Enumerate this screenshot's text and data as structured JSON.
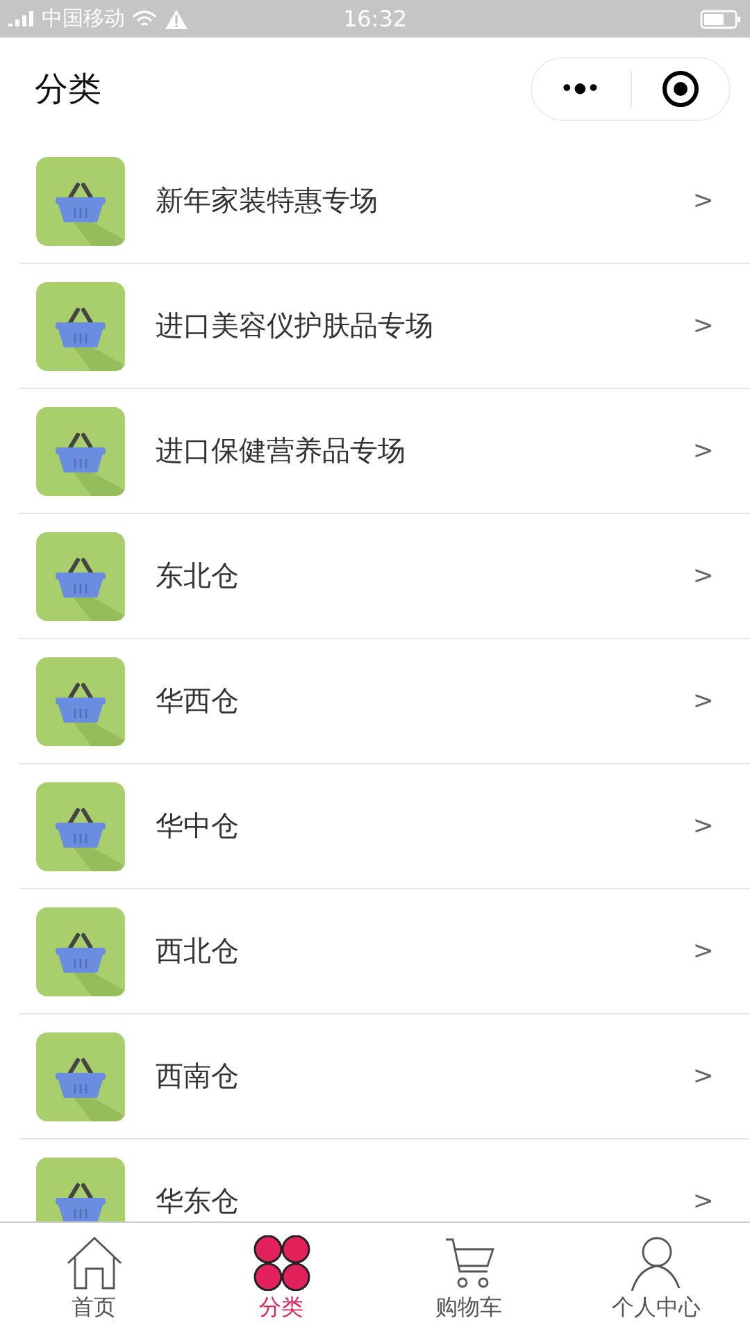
{
  "status_bar": {
    "carrier": "中国移动",
    "time": "16:32"
  },
  "header": {
    "title": "分类",
    "menu_glyph": "•●•"
  },
  "categories": [
    {
      "name": "新年家装特惠专场",
      "arrow": ">"
    },
    {
      "name": "进口美容仪护肤品专场",
      "arrow": ">"
    },
    {
      "name": "进口保健营养品专场",
      "arrow": ">"
    },
    {
      "name": "东北仓",
      "arrow": ">"
    },
    {
      "name": "华西仓",
      "arrow": ">"
    },
    {
      "name": "华中仓",
      "arrow": ">"
    },
    {
      "name": "西北仓",
      "arrow": ">"
    },
    {
      "name": "西南仓",
      "arrow": ">"
    },
    {
      "name": "华东仓",
      "arrow": ">"
    }
  ],
  "tab_bar": [
    {
      "kind": "home",
      "label": "首页",
      "selected": false
    },
    {
      "kind": "category",
      "label": "分类",
      "selected": true
    },
    {
      "kind": "cart",
      "label": "购物车",
      "selected": false
    },
    {
      "kind": "profile",
      "label": "个人中心",
      "selected": false
    }
  ]
}
